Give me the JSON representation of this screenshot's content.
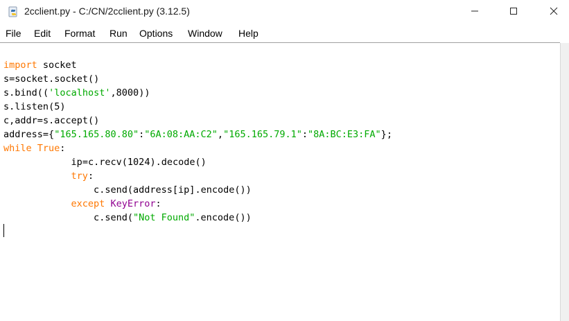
{
  "window": {
    "title": "2cclient.py - C:/CN/2cclient.py (3.12.5)",
    "icon": "python-idle-icon",
    "controls": [
      "minimize-icon",
      "maximize-icon",
      "close-icon"
    ]
  },
  "menu": {
    "items": [
      "File",
      "Edit",
      "Format",
      "Run",
      "Options",
      "Window",
      "Help"
    ]
  },
  "editor": {
    "lines": [
      "import socket",
      "s=socket.socket()",
      "s.bind(('localhost',8000))",
      "s.listen(5)",
      "c,addr=s.accept()",
      "address={\"165.165.80.80\":\"6A:08:AA:C2\",\"165.165.79.1\":\"8A:BC:E3:FA\"};",
      "while True:",
      "            ip=c.recv(1024).decode()",
      "            try:",
      "                c.send(address[ip].encode())",
      "            except KeyError:",
      "                c.send(\"Not Found\".encode())"
    ],
    "syntax_colors": {
      "keyword": "#ff7700",
      "string": "#00aa00",
      "builtin": "#900090",
      "default": "#000000"
    }
  }
}
